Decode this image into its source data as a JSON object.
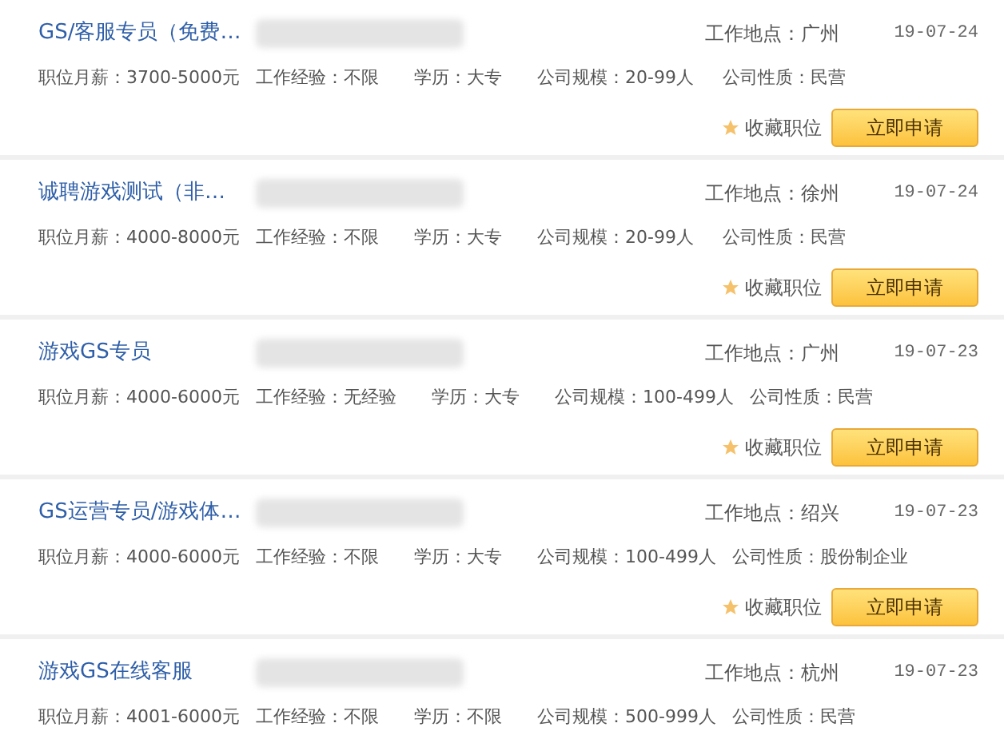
{
  "jobs": [
    {
      "title": "GS/客服专员（免费…",
      "location": "工作地点：广州",
      "date": "19-07-24",
      "salary": "职位月薪：3700-5000元",
      "experience": "工作经验：不限",
      "education": "学历：大专",
      "scale": "公司规模：20-99人",
      "nature": "公司性质：民营",
      "favorite": "收藏职位",
      "apply": "立即申请"
    },
    {
      "title": "诚聘游戏测试（非…",
      "location": "工作地点：徐州",
      "date": "19-07-24",
      "salary": "职位月薪：4000-8000元",
      "experience": "工作经验：不限",
      "education": "学历：大专",
      "scale": "公司规模：20-99人",
      "nature": "公司性质：民营",
      "favorite": "收藏职位",
      "apply": "立即申请"
    },
    {
      "title": "游戏GS专员",
      "location": "工作地点：广州",
      "date": "19-07-23",
      "salary": "职位月薪：4000-6000元",
      "experience": "工作经验：无经验",
      "education": "学历：大专",
      "scale": "公司规模：100-499人",
      "nature": "公司性质：民营",
      "favorite": "收藏职位",
      "apply": "立即申请"
    },
    {
      "title": "GS运营专员/游戏体…",
      "location": "工作地点：绍兴",
      "date": "19-07-23",
      "salary": "职位月薪：4000-6000元",
      "experience": "工作经验：不限",
      "education": "学历：大专",
      "scale": "公司规模：100-499人",
      "nature": "公司性质：股份制企业",
      "favorite": "收藏职位",
      "apply": "立即申请"
    },
    {
      "title": "游戏GS在线客服",
      "location": "工作地点：杭州",
      "date": "19-07-23",
      "salary": "职位月薪：4001-6000元",
      "experience": "工作经验：不限",
      "education": "学历：不限",
      "scale": "公司规模：500-999人",
      "nature": "公司性质：民营"
    }
  ]
}
